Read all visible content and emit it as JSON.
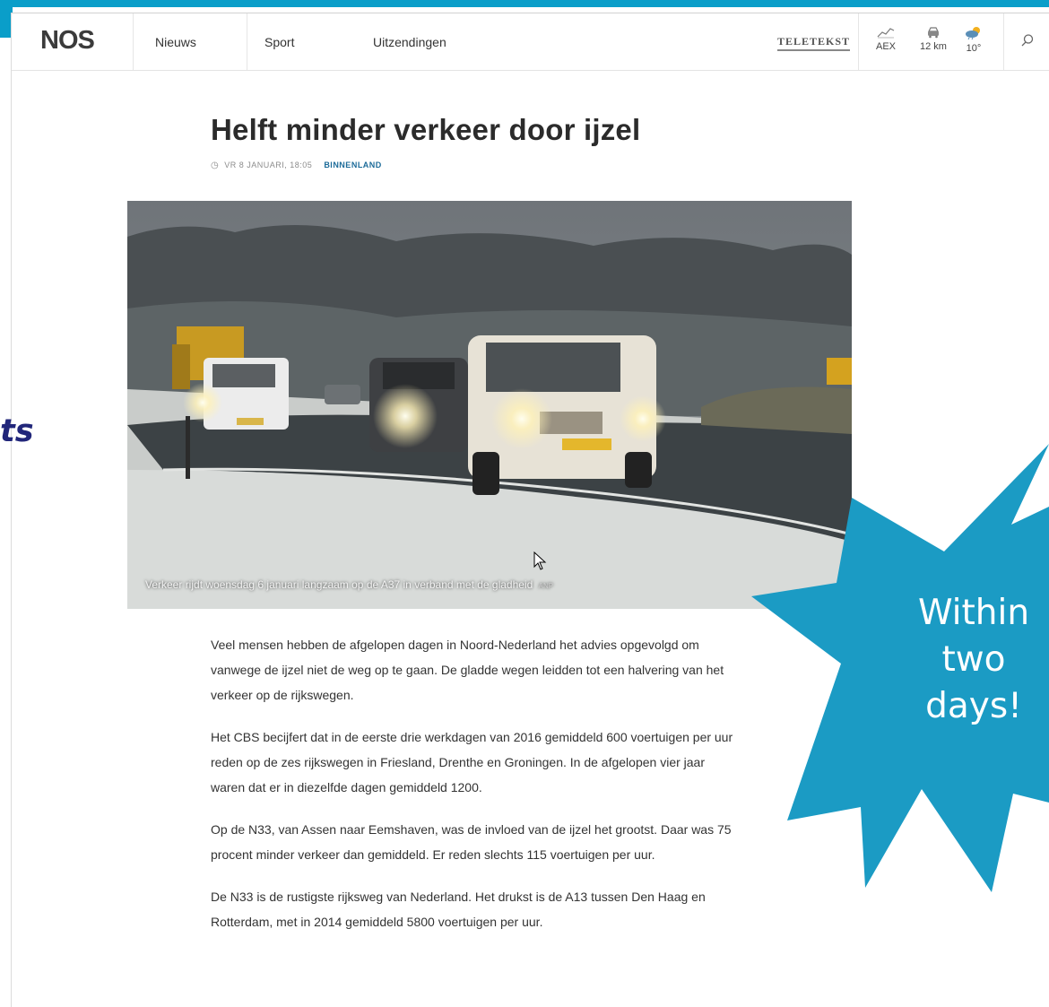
{
  "nav": {
    "logo_text": "NOS",
    "items": [
      {
        "label": "Nieuws"
      },
      {
        "label": "Sport"
      },
      {
        "label": "Uitzendingen"
      }
    ],
    "teletekst_label": "TELETEKST",
    "widgets": [
      {
        "label": "AEX",
        "icon": "stock-chart-icon"
      },
      {
        "label": "12 km",
        "icon": "car-icon"
      },
      {
        "label": "10°",
        "icon": "weather-cloud-icon"
      }
    ],
    "search_icon": "search-icon"
  },
  "article": {
    "title": "Helft minder verkeer door ijzel",
    "date": "VR 8 JANUARI, 18:05",
    "category": "BINNENLAND",
    "image_caption": "Verkeer rijdt woensdag 6 januari langzaam op de A37 in verband met de gladheid",
    "image_credit": "ANP",
    "paragraphs": [
      "Veel mensen hebben de afgelopen dagen in Noord-Nederland het advies opgevolgd om vanwege de ijzel niet de weg op te gaan. De gladde wegen leidden tot een halvering van het verkeer op de rijkswegen.",
      "Het CBS becijfert dat in de eerste drie werkdagen van 2016 gemiddeld 600 voertuigen per uur reden op de zes rijkswegen in Friesland, Drenthe en Groningen. In de afgelopen vier jaar waren dat er in diezelfde dagen gemiddeld 1200.",
      "Op de N33, van Assen naar Eemshaven, was de invloed van de ijzel het grootst. Daar was 75 procent minder verkeer dan gemiddeld. Er reden slechts 115 voertuigen per uur.",
      "De N33 is de rustigste rijksweg van Nederland. Het drukst is de A13 tussen Den Haag en Rotterdam, met in 2014 gemiddeld 5800 voertuigen per uur."
    ]
  },
  "slide": {
    "side_text": "ts",
    "callout_lines": [
      "Within",
      "two",
      "days!"
    ],
    "accent_color": "#0a9ec9",
    "callout_color": "#1b9bc4",
    "side_text_color": "#21267a"
  }
}
